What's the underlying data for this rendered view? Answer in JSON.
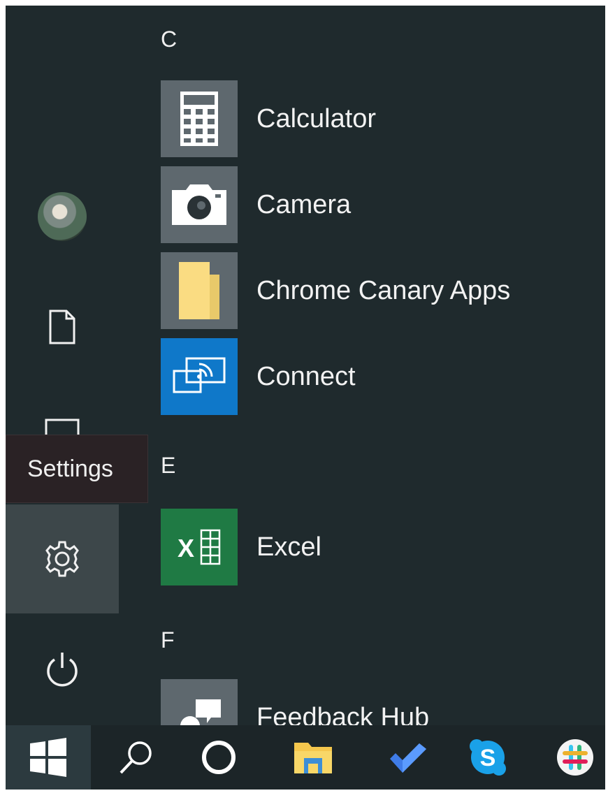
{
  "sidebar": {
    "items": [
      {
        "name": "account",
        "icon": "user-avatar-icon"
      },
      {
        "name": "documents",
        "icon": "document-icon"
      },
      {
        "name": "pictures",
        "icon": "pictures-icon"
      },
      {
        "name": "settings",
        "icon": "gear-icon"
      },
      {
        "name": "power",
        "icon": "power-icon"
      }
    ],
    "tooltip": "Settings"
  },
  "app_list": {
    "groups": [
      {
        "letter": "C",
        "apps": [
          {
            "label": "Calculator",
            "icon": "calculator-icon"
          },
          {
            "label": "Camera",
            "icon": "camera-icon"
          },
          {
            "label": "Chrome Canary Apps",
            "icon": "folder-icon"
          },
          {
            "label": "Connect",
            "icon": "connect-icon"
          }
        ]
      },
      {
        "letter": "E",
        "apps": [
          {
            "label": "Excel",
            "icon": "excel-icon"
          }
        ]
      },
      {
        "letter": "F",
        "apps": [
          {
            "label": "Feedback Hub",
            "icon": "feedback-hub-icon"
          }
        ]
      }
    ]
  },
  "taskbar": {
    "items": [
      {
        "name": "start",
        "icon": "windows-logo-icon"
      },
      {
        "name": "search",
        "icon": "search-icon"
      },
      {
        "name": "cortana",
        "icon": "cortana-icon"
      },
      {
        "name": "file-explorer",
        "icon": "folder-icon"
      },
      {
        "name": "todo",
        "icon": "checkmark-icon"
      },
      {
        "name": "skype",
        "icon": "skype-icon",
        "glyph": "S"
      },
      {
        "name": "slack",
        "icon": "slack-icon"
      }
    ]
  },
  "colors": {
    "background": "#1f2a2d",
    "tile_gray": "#5e686e",
    "tile_blue": "#0f78c9",
    "tile_green": "#1f7a44",
    "settings_highlight": "#3d474a"
  }
}
